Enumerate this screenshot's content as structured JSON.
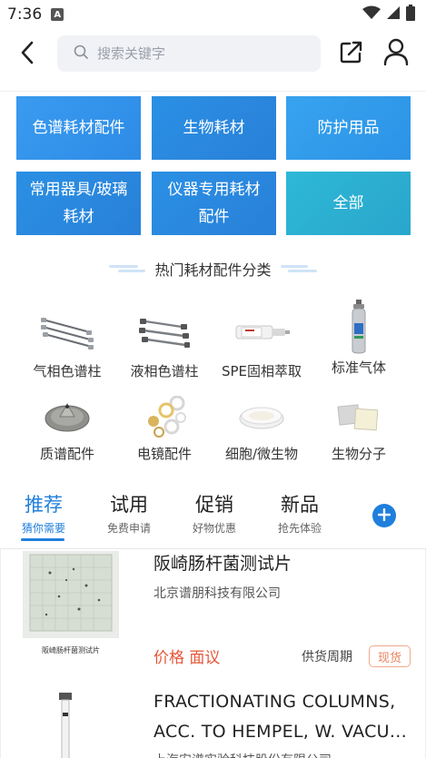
{
  "status_bar": {
    "time": "7:36",
    "notification_badge": "A",
    "icons": [
      "wifi-icon",
      "signal-icon",
      "battery-icon"
    ]
  },
  "header": {
    "search": {
      "placeholder": "搜索关键字",
      "value": ""
    },
    "icons": [
      "back-icon",
      "search-icon",
      "share-icon",
      "user-icon"
    ]
  },
  "categories": [
    {
      "label": "色谱耗材配件",
      "color": "#3a9bf0"
    },
    {
      "label": "生物耗材",
      "color": "#2a90e4"
    },
    {
      "label": "防护用品",
      "color": "#37a3ef"
    },
    {
      "label": "常用器具/玻璃耗材",
      "color": "#2a90e4"
    },
    {
      "label": "仪器专用耗材配件",
      "color": "#2a90e4"
    },
    {
      "label": "全部",
      "color": "#2eb8d6"
    }
  ],
  "hot_section": {
    "title": "热门耗材配件分类",
    "items": [
      {
        "label": "气相色谱柱",
        "icon": "gc-column-icon"
      },
      {
        "label": "液相色谱柱",
        "icon": "lc-column-icon"
      },
      {
        "label": "SPE固相萃取",
        "icon": "spe-cartridge-icon"
      },
      {
        "label": "标准气体",
        "icon": "gas-cylinder-icon"
      },
      {
        "label": "质谱配件",
        "icon": "ms-cone-icon"
      },
      {
        "label": "电镜配件",
        "icon": "em-parts-icon"
      },
      {
        "label": "细胞/微生物",
        "icon": "petri-dish-icon"
      },
      {
        "label": "生物分子",
        "icon": "membrane-icon"
      }
    ]
  },
  "tabs": [
    {
      "title": "推荐",
      "subtitle": "猜你需要",
      "active": true
    },
    {
      "title": "试用",
      "subtitle": "免费申请",
      "active": false
    },
    {
      "title": "促销",
      "subtitle": "好物优惠",
      "active": false
    },
    {
      "title": "新品",
      "subtitle": "抢先体验",
      "active": false
    }
  ],
  "accent_color": "#1f7fdc",
  "price_color": "#e4573a",
  "products": [
    {
      "title": "阪崎肠杆菌测试片",
      "company": "北京谱朋科技有限公司",
      "price": "价格 面议",
      "supply_label": "供货周期",
      "badge": "现货",
      "thumb_caption": "阪崎肠杆菌测试片"
    },
    {
      "title": "FRACTIONATING COLUMNS, ACC. TO HEMPEL, W. VACU...",
      "company": "上海安谱实验科技股份有限公司"
    }
  ]
}
